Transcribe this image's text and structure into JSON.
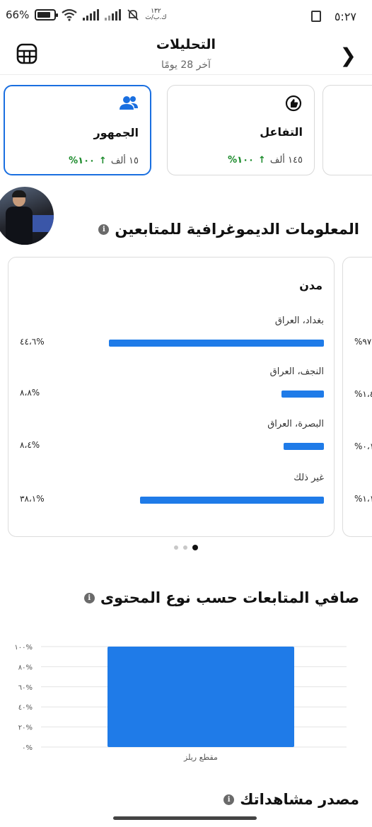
{
  "status_bar": {
    "time": "٥:٢٧",
    "network_label_top": "١٣٢",
    "network_label_bottom": "ك.ب/ث",
    "battery_text": "66%",
    "icons": [
      "screen-record-icon",
      "mute-bell-icon",
      "signal-icon",
      "wifi-icon",
      "battery-icon"
    ]
  },
  "header": {
    "title": "التحليلات",
    "subtitle": "آخر 28 يومًا",
    "back_icon": "chevron-right-icon",
    "table_icon": "table-icon"
  },
  "metric_cards": [
    {
      "title": "الجمهور",
      "value": "١٥ ألف",
      "change": "١٠٠%",
      "icon": "audience-icon",
      "active": true
    },
    {
      "title": "التفاعل",
      "value": "١٤٥ ألف",
      "change": "١٠٠%",
      "icon": "engagement-icon",
      "active": false
    }
  ],
  "demographics": {
    "section_title": "المعلومات الديموغرافية للمتابعين",
    "card_title": "مدن",
    "cities": [
      {
        "label": "بغداد، العراق",
        "percent_text": "%٤٤،٦",
        "value": 44.6
      },
      {
        "label": "النجف، العراق",
        "percent_text": "%٨،٨",
        "value": 8.8
      },
      {
        "label": "البصرة، العراق",
        "percent_text": "%٨،٤",
        "value": 8.4
      },
      {
        "label": "غير ذلك",
        "percent_text": "%٣٨،١",
        "value": 38.1
      }
    ],
    "peek_values": [
      "%٩٧",
      "%١،٤",
      "%٠،١",
      "%١،١"
    ],
    "pagination": {
      "count": 3,
      "active": 0
    }
  },
  "net_follows": {
    "section_title": "صافي المتابعات حسب نوع المحتوى"
  },
  "chart_data": {
    "type": "bar",
    "categories": [
      "مقطع ريلز"
    ],
    "values": [
      100
    ],
    "ylim": [
      0,
      100
    ],
    "ytick_labels": [
      "٠%",
      "٢٠%",
      "٤٠%",
      "٦٠%",
      "٨٠%",
      "١٠٠%"
    ],
    "yticks": [
      0,
      20,
      40,
      60,
      80,
      100
    ],
    "grid": true,
    "bar_color": "#1f7be8"
  },
  "source": {
    "section_title": "مصدر مشاهداتك"
  },
  "colors": {
    "accent": "#1a6fe0",
    "bar": "#1f7be8",
    "positive": "#1a8a2a"
  }
}
